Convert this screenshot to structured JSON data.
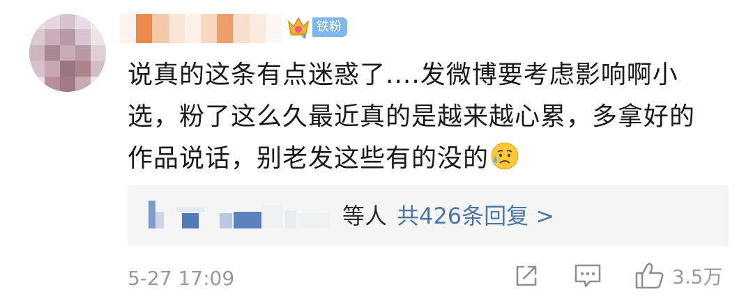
{
  "comment": {
    "user": {
      "badge_label": "铁粉",
      "badge_level": "4",
      "badge_icon": "crown-icon",
      "badge_color": "#7fb7ec"
    },
    "text_lines": [
      "说真的这条有点迷惑了....发微博要考虑影响啊小",
      "选，粉了这么久最近真的是越来越心累，多拿好的",
      "作品说话，别老发这些有的没的"
    ],
    "emoji": "sad-sweat-face-emoji",
    "replies": {
      "suffix": "等人",
      "summary": "共426条回复 >",
      "link_color": "#4a77a8"
    },
    "timestamp": "5-27 17:09",
    "actions": {
      "share_icon": "share-icon",
      "comment_icon": "comment-icon",
      "like_icon": "thumbs-up-icon",
      "like_count": "3.5万"
    }
  }
}
